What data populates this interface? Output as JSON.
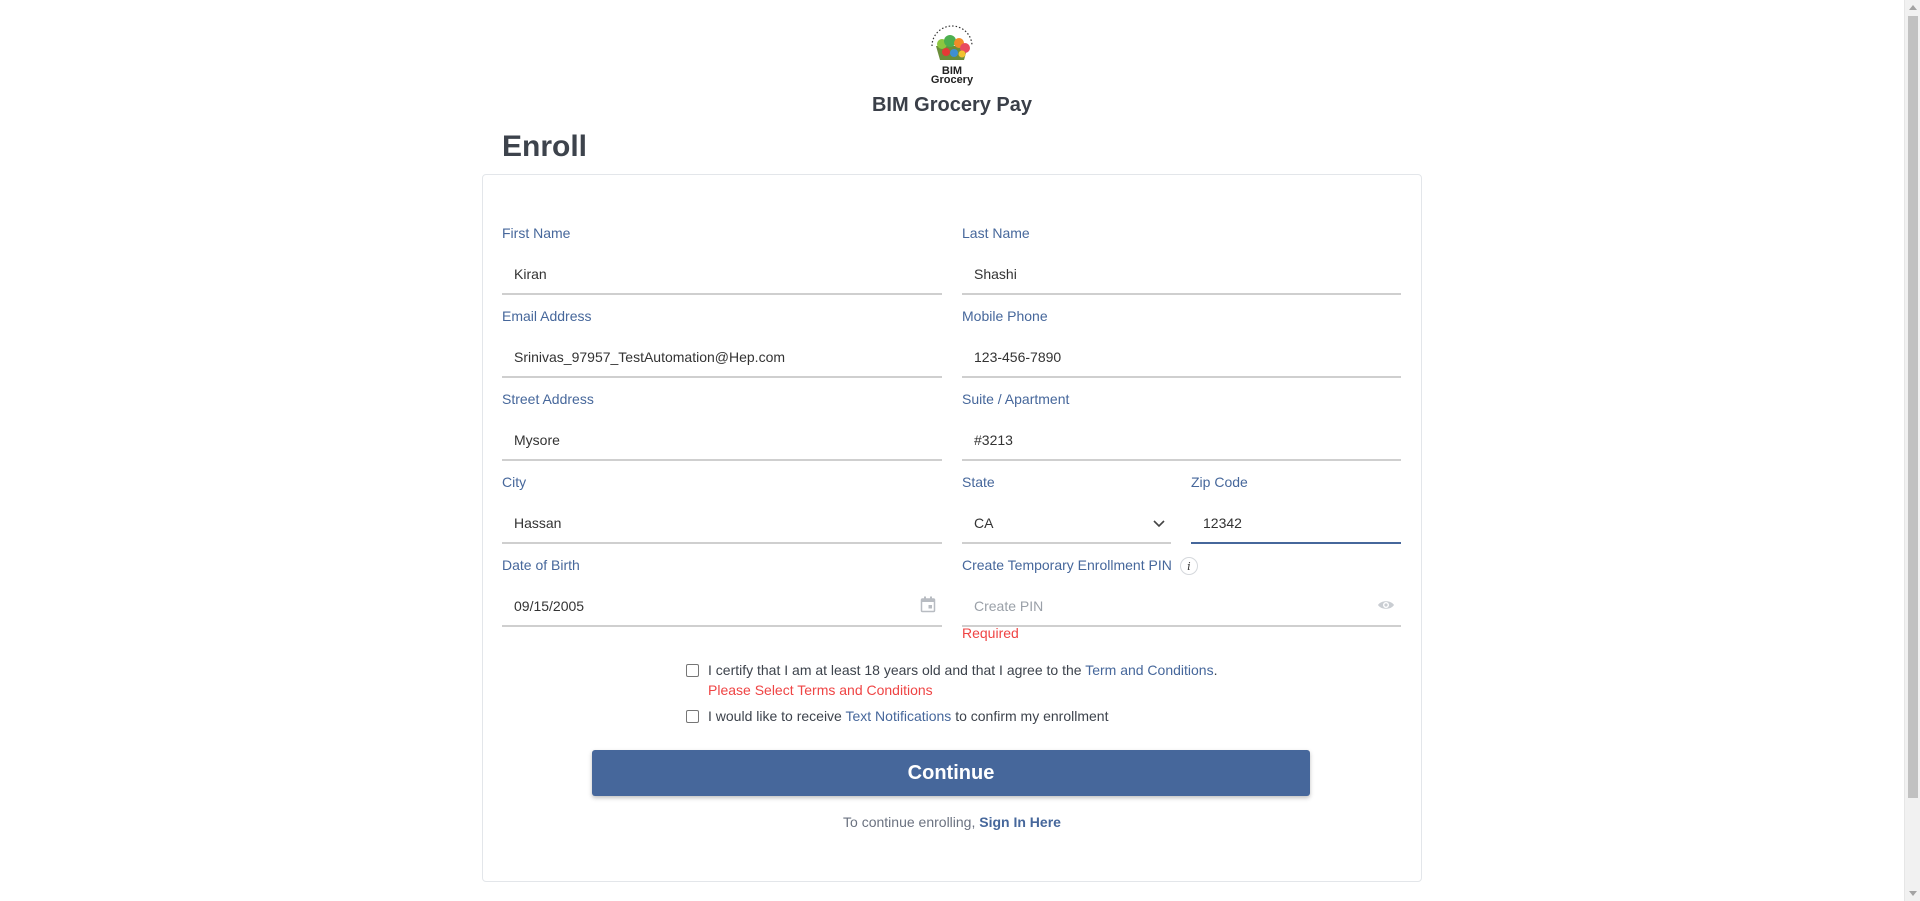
{
  "brand": {
    "logo_text_line1": "BIM",
    "logo_text_line2": "Grocery",
    "title": "BIM Grocery Pay"
  },
  "page": {
    "heading": "Enroll"
  },
  "form": {
    "first_name": {
      "label": "First Name",
      "value": "Kiran"
    },
    "last_name": {
      "label": "Last Name",
      "value": "Shashi"
    },
    "email": {
      "label": "Email Address",
      "value": "Srinivas_97957_TestAutomation@Hep.com"
    },
    "mobile": {
      "label": "Mobile Phone",
      "value": "123-456-7890"
    },
    "street": {
      "label": "Street Address",
      "value": "Mysore"
    },
    "suite": {
      "label": "Suite / Apartment",
      "value": "#3213"
    },
    "city": {
      "label": "City",
      "value": "Hassan"
    },
    "state": {
      "label": "State",
      "value": "CA"
    },
    "zip": {
      "label": "Zip Code",
      "value": "12342"
    },
    "dob": {
      "label": "Date of Birth",
      "value": "09/15/2005"
    },
    "pin": {
      "label": "Create Temporary Enrollment PIN",
      "placeholder": "Create PIN",
      "info": "i",
      "error": "Required"
    }
  },
  "consent": {
    "terms_prefix": "I certify that I am at least 18 years old and that I agree to the ",
    "terms_link": "Term and Conditions",
    "terms_suffix": ".",
    "terms_error": "Please Select Terms and Conditions",
    "sms_prefix": "I would like to receive ",
    "sms_link": "Text Notifications",
    "sms_suffix": " to confirm my enrollment"
  },
  "actions": {
    "continue_label": "Continue",
    "signin_prefix": "To continue enrolling, ",
    "signin_link": "Sign In Here"
  },
  "colors": {
    "accent": "#46679b",
    "error": "#ef4444",
    "heading": "#3d434c"
  }
}
